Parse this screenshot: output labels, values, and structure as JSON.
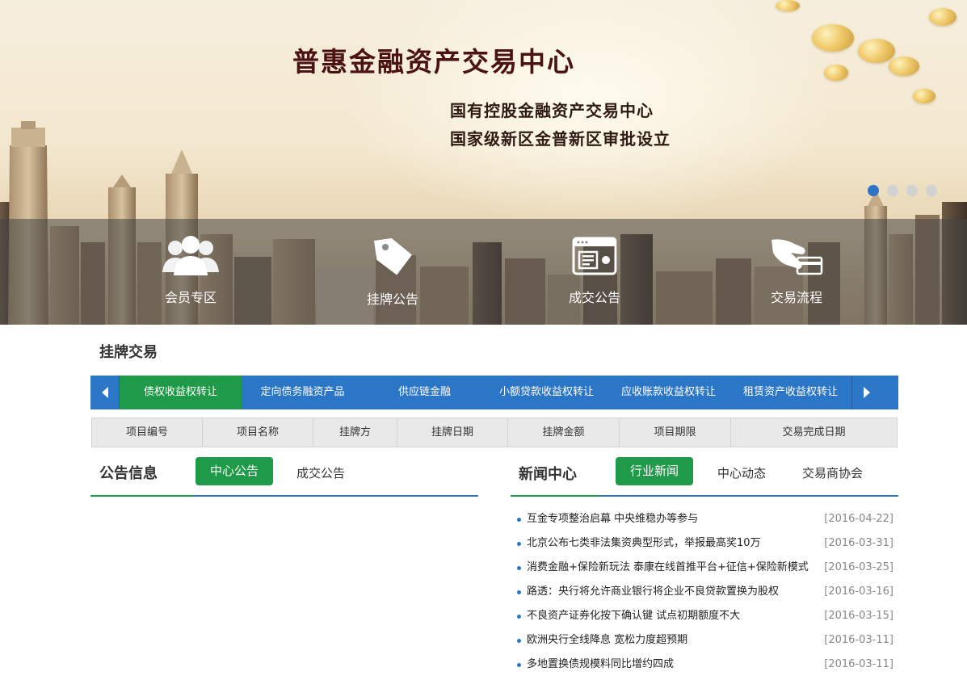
{
  "banner": {
    "title": "普惠金融资产交易中心",
    "subtitle_1": "国有控股金融资产交易中心",
    "subtitle_2": "国家级新区金普新区审批设立",
    "slides": {
      "total": 4,
      "active": 1
    },
    "colors": {
      "title": "#4a1212",
      "active_dot": "#2c74c4"
    }
  },
  "quick_links": [
    {
      "label": "会员专区",
      "icon": "members-icon"
    },
    {
      "label": "挂牌公告",
      "icon": "tag-icon"
    },
    {
      "label": "成交公告",
      "icon": "browser-window-icon"
    },
    {
      "label": "交易流程",
      "icon": "hand-card-icon"
    }
  ],
  "listing": {
    "title": "挂牌交易",
    "tabs": [
      "债权收益权转让",
      "定向债务融资产品",
      "供应链金融",
      "小额贷款收益权转让",
      "应收账款收益权转让",
      "租赁资产收益权转让"
    ],
    "active_tab": 0,
    "columns": [
      "项目编号",
      "项目名称",
      "挂牌方",
      "挂牌日期",
      "挂牌金额",
      "项目期限",
      "交易完成日期"
    ]
  },
  "announcements": {
    "title": "公告信息",
    "tabs": [
      "中心公告",
      "成交公告"
    ],
    "active_tab": 0
  },
  "news": {
    "title": "新闻中心",
    "tabs": [
      "行业新闻",
      "中心动态",
      "交易商协会"
    ],
    "active_tab": 0,
    "items": [
      {
        "title": "互金专项整治启幕 中央维稳办等参与",
        "date": "[2016-04-22]"
      },
      {
        "title": "北京公布七类非法集资典型形式，举报最高奖10万",
        "date": "[2016-03-31]"
      },
      {
        "title": "消费金融+保险新玩法 泰康在线首推平台+征信+保险新模式",
        "date": "[2016-03-25]"
      },
      {
        "title": "路透：央行将允许商业银行将企业不良贷款置换为股权",
        "date": "[2016-03-16]"
      },
      {
        "title": "不良资产证券化按下确认键 试点初期额度不大",
        "date": "[2016-03-15]"
      },
      {
        "title": "欧洲央行全线降息 宽松力度超预期",
        "date": "[2016-03-11]"
      },
      {
        "title": "多地置换债规模料同比增约四成",
        "date": "[2016-03-11]"
      }
    ]
  },
  "colors": {
    "primary_blue": "#2b76c6",
    "active_green": "#1f9a48"
  }
}
